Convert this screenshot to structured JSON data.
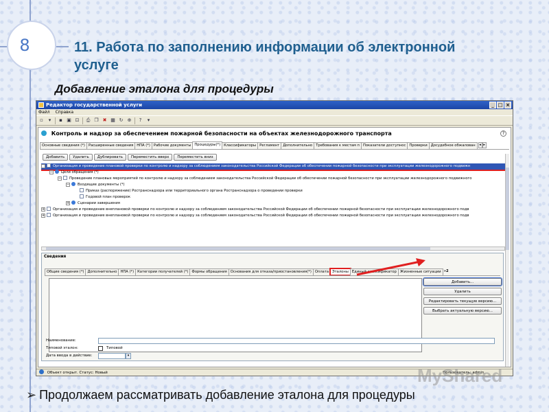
{
  "slide": {
    "number": "8",
    "title": "11. Работа по заполнению информации об электронной услуге",
    "subtitle": "Добавление эталона для процедуры",
    "bullet": "Продолжаем рассматривать добавление эталона для процедуры",
    "watermark": "MyShared"
  },
  "window": {
    "title": "Редактор государственной услуги",
    "menu": [
      "Файл",
      "Справка"
    ],
    "service_title": "Контроль и надзор за обеспечением пожарной безопасности на объектах железнодорожного транспорта",
    "help": "?"
  },
  "tabs": [
    "Основные сведения (*)",
    "Расширенные сведения",
    "НПА (*)",
    "Рабочие документы",
    "Процедуры(*)",
    "Классификаторы",
    "Регламент",
    "Дополнительно",
    "Требования к местам п",
    "Показатели доступнос",
    "Проверки",
    "Досудебное обжалован"
  ],
  "active_tab": "Процедуры(*)",
  "proc_buttons": {
    "add": "Добавить",
    "delete": "Удалить",
    "duplicate": "Дублировать",
    "move_up": "Переместить вверх",
    "move_down": "Переместить вниз"
  },
  "tree": [
    "Организация и проведение плановой проверки по контролю и надзору за соблюдением законодательства Российской Федерации об обеспечении пожарной безопасности при эксплуатации железнодорожного подвижн",
    "Цели обращения (*)",
    "Проведение плановых мероприятий по контролю и надзору за соблюдением законодательства Российской Федерации об обеспечении пожарной безопасности при эксплуатации железнодорожного подвижного",
    "Входящие документы (*)",
    "Приказ (распоряжение) Ространснадзора или территориального органа Ространснадзора о проведении проверки",
    "Годовой план проверок",
    "Сценарии завершения",
    "Организация и проведение внеплановой проверки по контролю и надзору за соблюдением законодательства Российской Федерации об обеспечении пожарной безопасности при эксплуатации железнодорожного подв",
    "Организация и проведение внеплановой проверки по контролю и надзору за соблюдением законодательства Российской Федерации об обеспечении пожарной безопасности при эксплуатации железнодорожного подв"
  ],
  "details": {
    "title": "Сведения",
    "tabs": [
      "Общие сведения (*)",
      "Дополнительно",
      "НПА (*)",
      "Категории получателей (*)",
      "Формы обращения",
      "Основания для отказа/приостановления(*)",
      "Оплата",
      "Эталоны",
      "Единый классификатор",
      "Жизненные ситуации"
    ],
    "more_tabs": "»2",
    "active_tab": "Эталоны",
    "buttons": {
      "add": "Добавить...",
      "delete": "Удалить",
      "edit_version": "Редактировать текущую версию...",
      "select_version": "Выбрать актуальную версию..."
    },
    "form": {
      "name_label": "Наименование:",
      "name_value": "",
      "typical_label": "Типовой эталон:",
      "typical_checkbox": "Типовой",
      "date_label": "Дата ввода в действие:",
      "date_value": ""
    }
  },
  "status": {
    "text": "Объект открыт. Статус: Новый",
    "user": "Пользователь: admin."
  },
  "colors": {
    "title_blue": "#1f5f8f",
    "selection": "#2f56b5",
    "highlight_red": "#e02020"
  }
}
